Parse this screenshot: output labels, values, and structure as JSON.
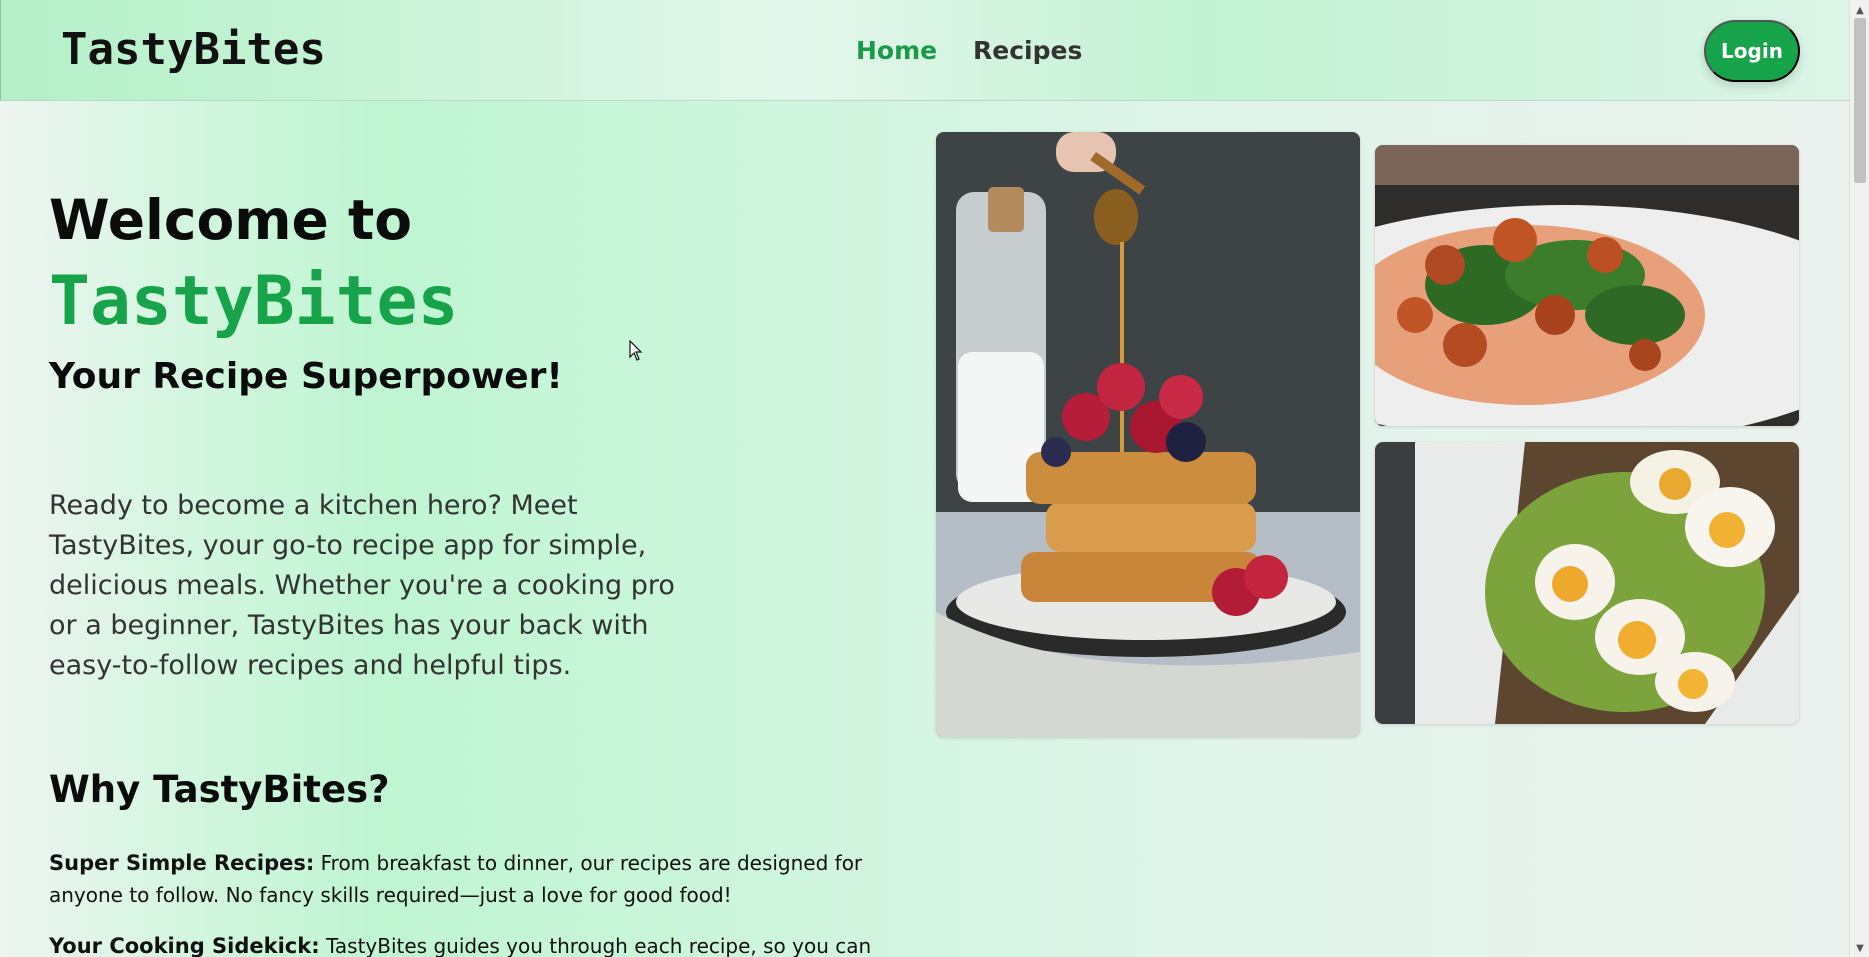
{
  "navbar": {
    "brand": "TastyBites",
    "links": [
      {
        "label": "Home",
        "active": true
      },
      {
        "label": "Recipes",
        "active": false
      }
    ],
    "login_label": "Login"
  },
  "hero": {
    "title_line1": "Welcome to",
    "title_brand": "TastyBites",
    "subtitle": "Your Recipe Superpower!",
    "description": "Ready to become a kitchen hero? Meet TastyBites, your go-to recipe app for simple, delicious meals. Whether you're a cooking pro or a beginner, TastyBites has your back with easy-to-follow recipes and helpful tips."
  },
  "why": {
    "title": "Why TastyBites?",
    "features": [
      {
        "heading": "Super Simple Recipes:",
        "text": " From breakfast to dinner, our recipes are designed for anyone to follow. No fancy skills required—just a love for good food!"
      },
      {
        "heading": "Your Cooking Sidekick:",
        "text": " TastyBites guides you through each recipe, so you can cook"
      }
    ]
  },
  "colors": {
    "accent": "#16a34a",
    "text": "#0b0b0b"
  }
}
